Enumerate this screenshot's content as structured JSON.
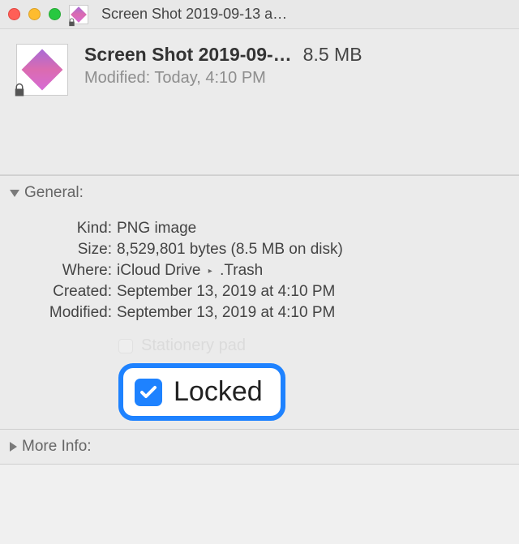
{
  "window": {
    "title": "Screen Shot 2019-09-13 a…"
  },
  "header": {
    "filename": "Screen Shot 2019-09-…",
    "size": "8.5 MB",
    "modified_label": "Modified:",
    "modified_value": "Today, 4:10 PM"
  },
  "general": {
    "title": "General:",
    "kind_label": "Kind:",
    "kind_value": "PNG image",
    "size_label": "Size:",
    "size_value": "8,529,801 bytes (8.5 MB on disk)",
    "where_label": "Where:",
    "where_value1": "iCloud Drive",
    "where_value2": ".Trash",
    "created_label": "Created:",
    "created_value": "September 13, 2019 at 4:10 PM",
    "modified_label": "Modified:",
    "modified_value": "September 13, 2019 at 4:10 PM",
    "stationery_label": "Stationery pad",
    "locked_label": "Locked"
  },
  "moreinfo": {
    "title": "More Info:"
  }
}
